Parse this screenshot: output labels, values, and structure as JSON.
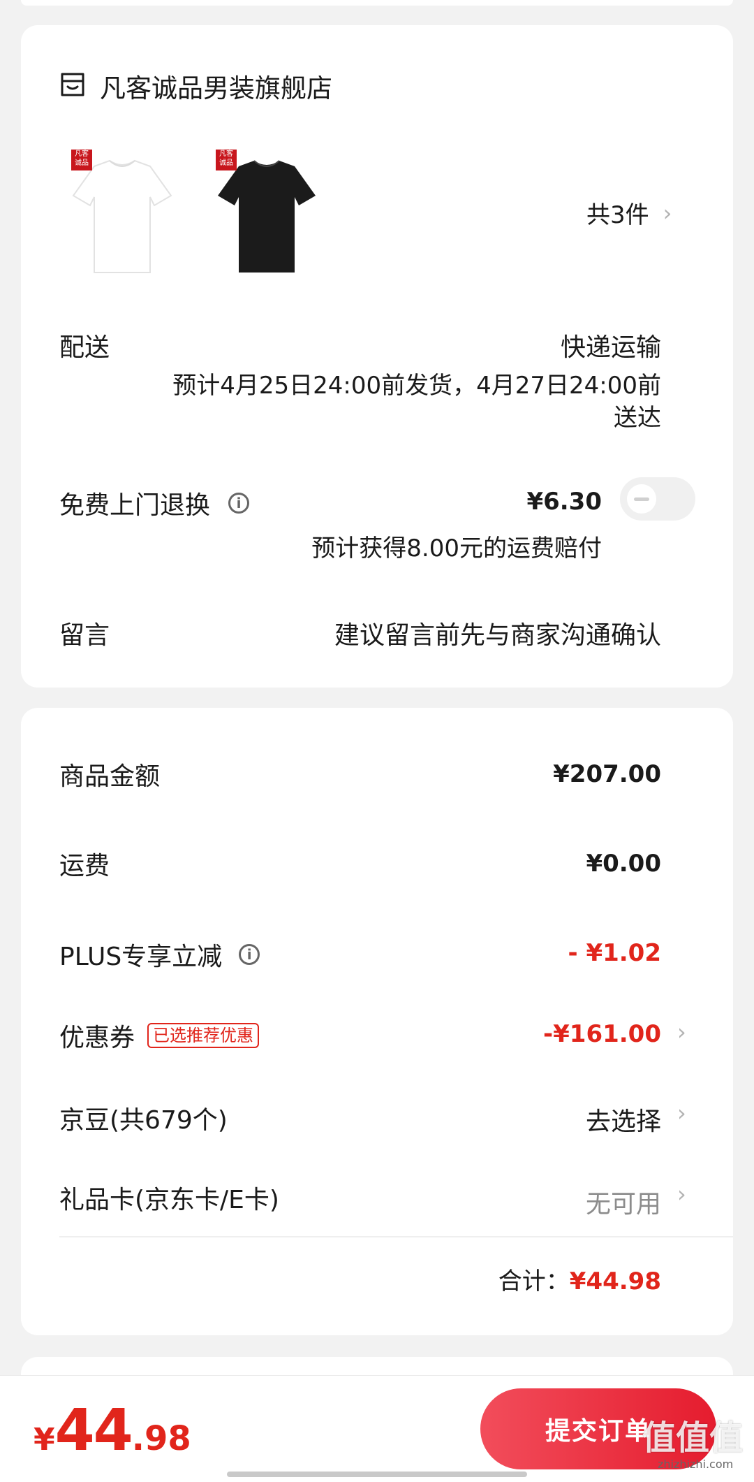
{
  "store": {
    "name": "凡客诚品男装旗舰店",
    "icon": "store-icon"
  },
  "products": {
    "items": [
      {
        "badge": "凡客\n诚品",
        "color": "white"
      },
      {
        "badge": "凡客\n诚品",
        "color": "black"
      }
    ],
    "count_label": "共3件"
  },
  "delivery": {
    "label": "配送",
    "method": "快递运输",
    "eta_line1": "预计4月25日24:00前发货，4月27日24:00前",
    "eta_line2": "送达"
  },
  "return_service": {
    "label": "免费上门退换",
    "price": "¥6.30",
    "compensation": "预计获得8.00元的运费赔付",
    "enabled": false
  },
  "message": {
    "label": "留言",
    "placeholder": "建议留言前先与商家沟通确认"
  },
  "summary": {
    "goods_amount_label": "商品金额",
    "goods_amount": "¥207.00",
    "shipping_label": "运费",
    "shipping": "¥0.00",
    "plus_label": "PLUS专享立减",
    "plus_value": "- ¥1.02",
    "coupon_label": "优惠券",
    "coupon_tag": "已选推荐优惠",
    "coupon_value": "-¥161.00",
    "jd_beans_label": "京豆(共679个)",
    "jd_beans_value": "去选择",
    "gift_card_label": "礼品卡(京东卡/E卡)",
    "gift_card_value": "无可用",
    "total_label": "合计：",
    "total_value": "¥44.98"
  },
  "bottom_bar": {
    "currency": "¥",
    "price_int": "44",
    "price_dec": ".98",
    "submit_label": "提交订单"
  },
  "watermark": {
    "text": "值值值",
    "url": "zhizhizhi.com"
  },
  "colors": {
    "accent": "#e1251b",
    "background": "#f2f2f2",
    "card": "#ffffff"
  }
}
